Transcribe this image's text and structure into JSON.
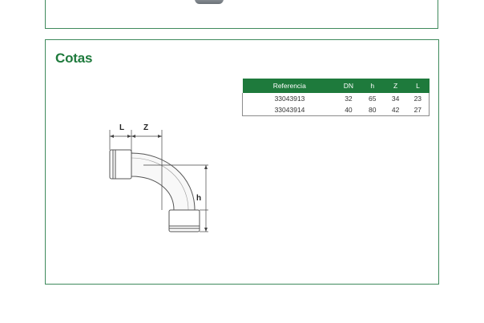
{
  "section_title": "Cotas",
  "table": {
    "headers": {
      "ref": "Referencia",
      "dn": "DN",
      "h": "h",
      "z": "Z",
      "l": "L"
    },
    "rows": [
      {
        "ref": "33043913",
        "dn": "32",
        "h": "65",
        "z": "34",
        "l": "23"
      },
      {
        "ref": "33043914",
        "dn": "40",
        "h": "80",
        "z": "42",
        "l": "27"
      }
    ],
    "header_color": "#1e7a3c"
  },
  "drawing": {
    "label_l": "L",
    "label_z": "Z",
    "label_h": "h"
  },
  "accent_color": "#1e7a3c",
  "border_color": "#3f8a5c"
}
